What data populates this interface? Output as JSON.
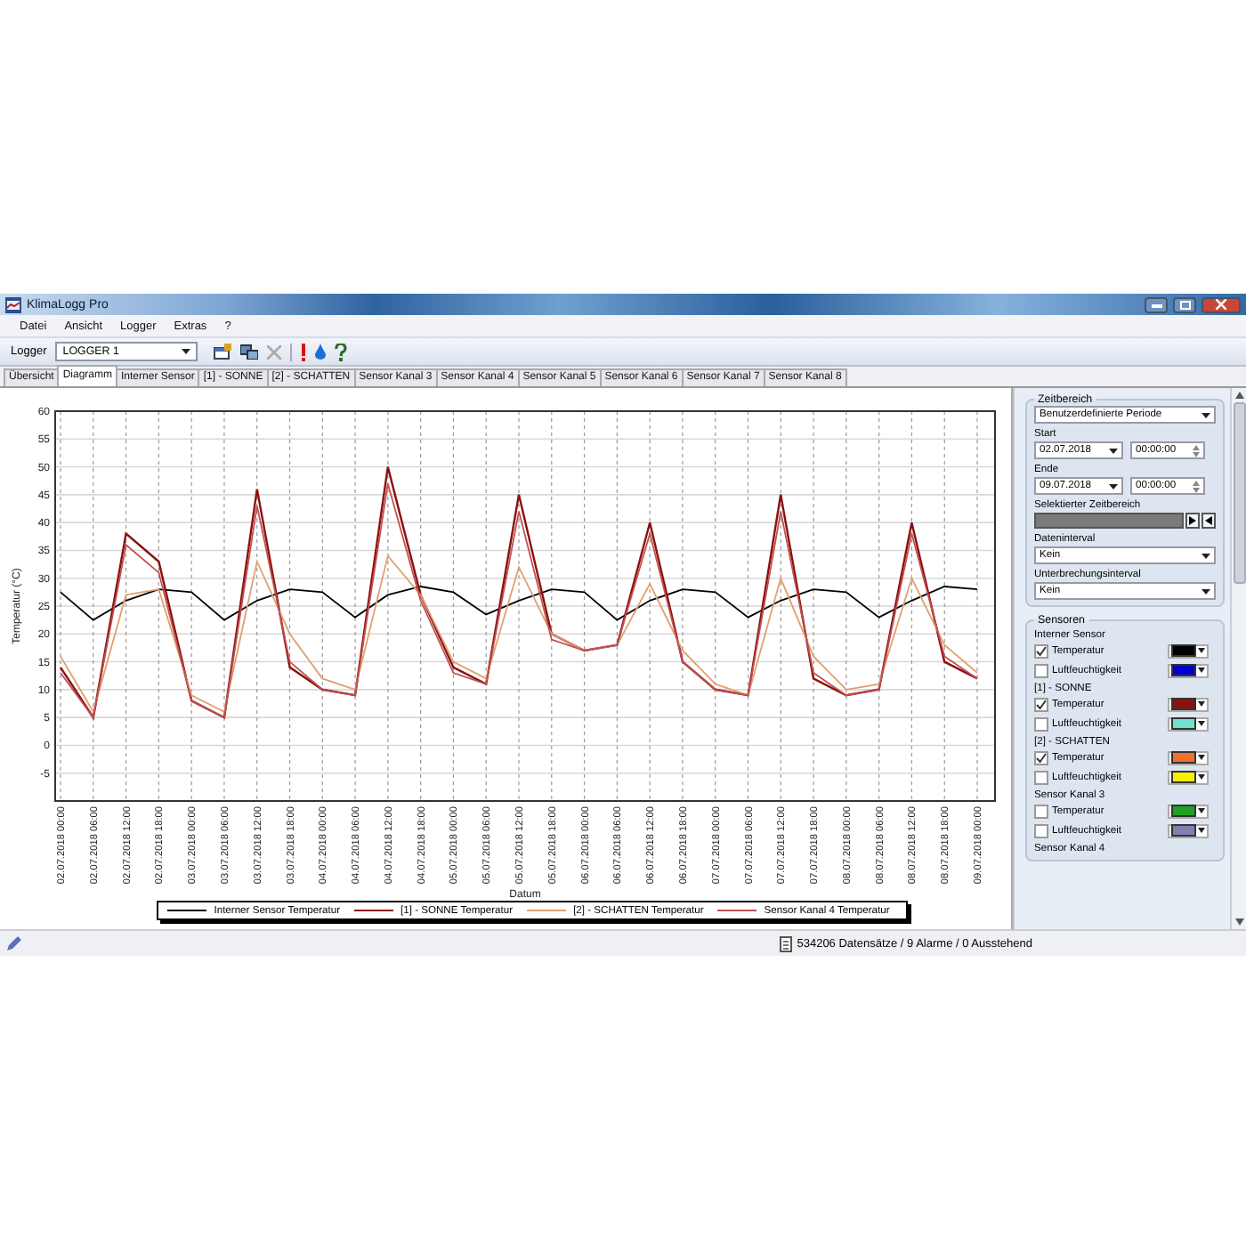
{
  "window": {
    "title": "KlimaLogg Pro"
  },
  "menu": [
    "Datei",
    "Ansicht",
    "Logger",
    "Extras",
    "?"
  ],
  "toolbar": {
    "logger_label": "Logger",
    "logger_select": "LOGGER 1"
  },
  "tabs": [
    {
      "label": "Übersicht",
      "selected": false
    },
    {
      "label": "Diagramm",
      "selected": true
    },
    {
      "label": "Interner Sensor",
      "selected": false
    },
    {
      "label": "[1] - SONNE",
      "selected": false
    },
    {
      "label": "[2] - SCHATTEN",
      "selected": false
    },
    {
      "label": "Sensor Kanal 3",
      "selected": false
    },
    {
      "label": "Sensor Kanal 4",
      "selected": false
    },
    {
      "label": "Sensor Kanal 5",
      "selected": false
    },
    {
      "label": "Sensor Kanal 6",
      "selected": false
    },
    {
      "label": "Sensor Kanal 7",
      "selected": false
    },
    {
      "label": "Sensor Kanal 8",
      "selected": false
    }
  ],
  "chart": {
    "chart_data": {
      "type": "line",
      "grid": true,
      "legend": true,
      "xlabel": "Datum",
      "ylabel": "Temperatur (°C)",
      "ylim": [
        -10,
        60
      ],
      "yticks": [
        -5,
        0,
        5,
        10,
        15,
        20,
        25,
        30,
        35,
        40,
        45,
        50,
        55,
        60
      ],
      "x": [
        "02.07.2018 00:00",
        "02.07.2018 06:00",
        "02.07.2018 12:00",
        "02.07.2018 18:00",
        "03.07.2018 00:00",
        "03.07.2018 06:00",
        "03.07.2018 12:00",
        "03.07.2018 18:00",
        "04.07.2018 00:00",
        "04.07.2018 06:00",
        "04.07.2018 12:00",
        "04.07.2018 18:00",
        "05.07.2018 00:00",
        "05.07.2018 06:00",
        "05.07.2018 12:00",
        "05.07.2018 18:00",
        "06.07.2018 00:00",
        "06.07.2018 06:00",
        "06.07.2018 12:00",
        "06.07.2018 18:00",
        "07.07.2018 00:00",
        "07.07.2018 06:00",
        "07.07.2018 12:00",
        "07.07.2018 18:00",
        "08.07.2018 00:00",
        "08.07.2018 06:00",
        "08.07.2018 12:00",
        "08.07.2018 18:00",
        "09.07.2018 00:00"
      ],
      "series": [
        {
          "name": "Interner Sensor Temperatur",
          "color": "#000000",
          "values": [
            27.5,
            22.5,
            26,
            28,
            27.5,
            22.5,
            26,
            28,
            27.5,
            23,
            27,
            28.5,
            27.5,
            23.5,
            26,
            28,
            27.5,
            22.5,
            26,
            28,
            27.5,
            23,
            26,
            28,
            27.5,
            23,
            26,
            28.5,
            28
          ]
        },
        {
          "name": "[1] - SONNE Temperatur",
          "color": "#8b1010",
          "values": [
            14,
            5,
            38,
            33,
            8,
            5,
            46,
            14,
            10,
            9,
            50,
            27,
            14,
            11,
            45,
            20,
            17,
            18,
            40,
            15,
            10,
            9,
            45,
            12,
            9,
            10,
            40,
            15,
            12
          ]
        },
        {
          "name": "[2] - SCHATTEN Temperatur",
          "color": "#e0a070",
          "values": [
            16,
            6,
            27,
            28,
            9,
            6,
            33,
            20,
            12,
            10,
            34,
            27,
            15,
            12,
            32,
            20,
            17,
            18,
            29,
            17,
            11,
            9,
            30,
            16,
            10,
            11,
            30,
            18,
            13
          ]
        },
        {
          "name": "Sensor Kanal 4 Temperatur",
          "color": "#c05050",
          "values": [
            13,
            5,
            36,
            31,
            8,
            5,
            43,
            15,
            10,
            9,
            47,
            26,
            13,
            11,
            42,
            19,
            17,
            18,
            38,
            15,
            10,
            9,
            42,
            13,
            9,
            10,
            38,
            16,
            12
          ]
        }
      ]
    }
  },
  "side_panel": {
    "time_range": {
      "title": "Zeitbereich",
      "period": "Benutzerdefinierte Periode",
      "start_label": "Start",
      "start_date": "02.07.2018",
      "start_time": "00:00:00",
      "end_label": "Ende",
      "end_date": "09.07.2018",
      "end_time": "00:00:00",
      "selection_label": "Selektierter Zeitbereich",
      "data_interval_label": "Dateninterval",
      "data_interval": "Kein",
      "break_interval_label": "Unterbrechungsinterval",
      "break_interval": "Kein"
    },
    "sensors": {
      "title": "Sensoren",
      "groups": [
        {
          "name": "Interner Sensor",
          "items": [
            {
              "label": "Temperatur",
              "checked": true,
              "color": "#000000"
            },
            {
              "label": "Luftfeuchtigkeit",
              "checked": false,
              "color": "#0000cc"
            }
          ]
        },
        {
          "name": "[1] - SONNE",
          "items": [
            {
              "label": "Temperatur",
              "checked": true,
              "color": "#8b1010"
            },
            {
              "label": "Luftfeuchtigkeit",
              "checked": false,
              "color": "#70e0d0"
            }
          ]
        },
        {
          "name": "[2] - SCHATTEN",
          "items": [
            {
              "label": "Temperatur",
              "checked": true,
              "color": "#f07030"
            },
            {
              "label": "Luftfeuchtigkeit",
              "checked": false,
              "color": "#f0f000"
            }
          ]
        },
        {
          "name": "Sensor Kanal 3",
          "items": [
            {
              "label": "Temperatur",
              "checked": false,
              "color": "#20a020"
            },
            {
              "label": "Luftfeuchtigkeit",
              "checked": false,
              "color": "#8080b0"
            }
          ]
        },
        {
          "name": "Sensor Kanal 4"
        }
      ]
    }
  },
  "status_bar": {
    "text": "534206 Datensätze / 9 Alarme / 0 Ausstehend"
  }
}
